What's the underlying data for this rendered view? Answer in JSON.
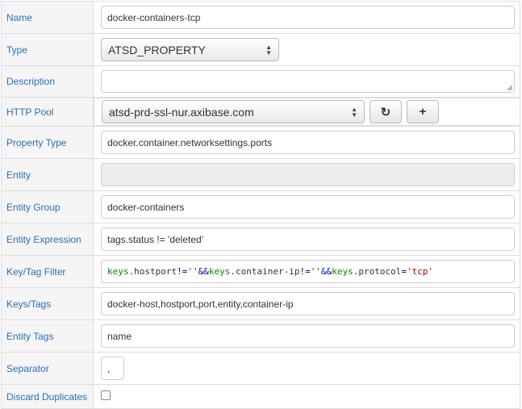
{
  "fields": [
    {
      "label": "Name",
      "value": "docker-containers-tcp"
    },
    {
      "label": "Type",
      "value": "ATSD_PROPERTY"
    },
    {
      "label": "Description",
      "value": ""
    },
    {
      "label": "HTTP Pool",
      "value": "atsd-prd-ssl-nur.axibase.com"
    },
    {
      "label": "Property Type",
      "value": "docker.container.networksettings.ports"
    },
    {
      "label": "Entity",
      "value": ""
    },
    {
      "label": "Entity Group",
      "value": "docker-containers"
    },
    {
      "label": "Entity Expression",
      "value": "tags.status != 'deleted'"
    },
    {
      "label": "Key/Tag Filter",
      "value": "keys.hostport != '' && keys.container-ip != '' && keys.protocol = 'tcp'"
    },
    {
      "label": "Keys/Tags",
      "value": "docker-host,hostport,port,entity,container-ip"
    },
    {
      "label": "Entity Tags",
      "value": "name"
    },
    {
      "label": "Separator",
      "value": ","
    },
    {
      "label": "Discard Duplicates",
      "value": false
    }
  ],
  "filter_tokens": {
    "k1": "keys",
    "f1": ".hostport",
    "op1": " != ",
    "s1": "''",
    "and1": " && ",
    "k2": "keys",
    "f2": ".container-ip",
    "op2": " != ",
    "s2": "''",
    "and2": " && ",
    "k3": "keys",
    "f3": ".protocol",
    "op3": " = ",
    "s3": "'tcp'"
  },
  "buttons": {
    "refresh": "↻",
    "add": "+"
  },
  "icons": {
    "refresh_button": "refresh-icon",
    "add_button": "plus-icon"
  }
}
